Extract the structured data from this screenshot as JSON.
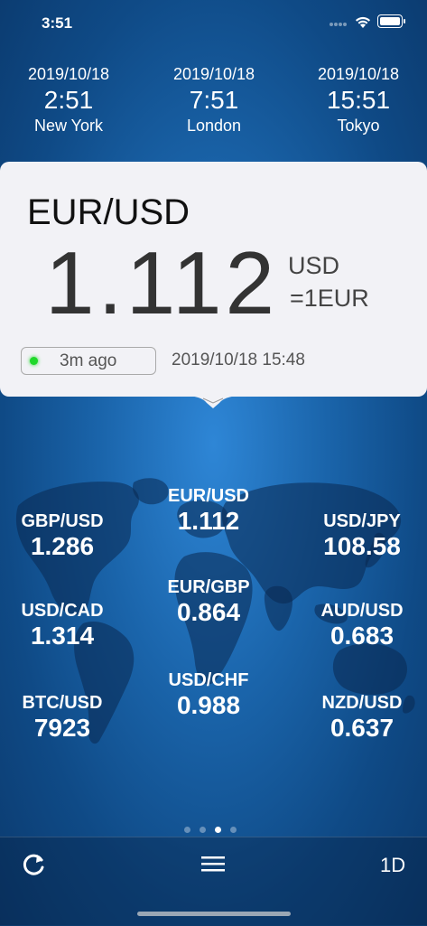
{
  "status": {
    "time": "3:51"
  },
  "clocks": [
    {
      "date": "2019/10/18",
      "time": "2:51",
      "city": "New York"
    },
    {
      "date": "2019/10/18",
      "time": "7:51",
      "city": "London"
    },
    {
      "date": "2019/10/18",
      "time": "15:51",
      "city": "Tokyo"
    }
  ],
  "card": {
    "pair": "EUR/USD",
    "rate": "1.112",
    "unit_line1": "USD",
    "unit_line2": "=1EUR",
    "updated_ago": "3m ago",
    "timestamp": "2019/10/18 15:48",
    "status_color": "#1fd82a"
  },
  "quotes": [
    {
      "name": "GBP/USD",
      "value": "1.286"
    },
    {
      "name": "EUR/USD",
      "value": "1.112"
    },
    {
      "name": "USD/JPY",
      "value": "108.58"
    },
    {
      "name": "USD/CAD",
      "value": "1.314"
    },
    {
      "name": "EUR/GBP",
      "value": "0.864"
    },
    {
      "name": "AUD/USD",
      "value": "0.683"
    },
    {
      "name": "BTC/USD",
      "value": "7923"
    },
    {
      "name": "USD/CHF",
      "value": "0.988"
    },
    {
      "name": "NZD/USD",
      "value": "0.637"
    }
  ],
  "pager": {
    "count": 4,
    "current": 3
  },
  "toolbar": {
    "refresh_icon": "refresh-icon",
    "menu_icon": "menu-icon",
    "period": "1D"
  }
}
